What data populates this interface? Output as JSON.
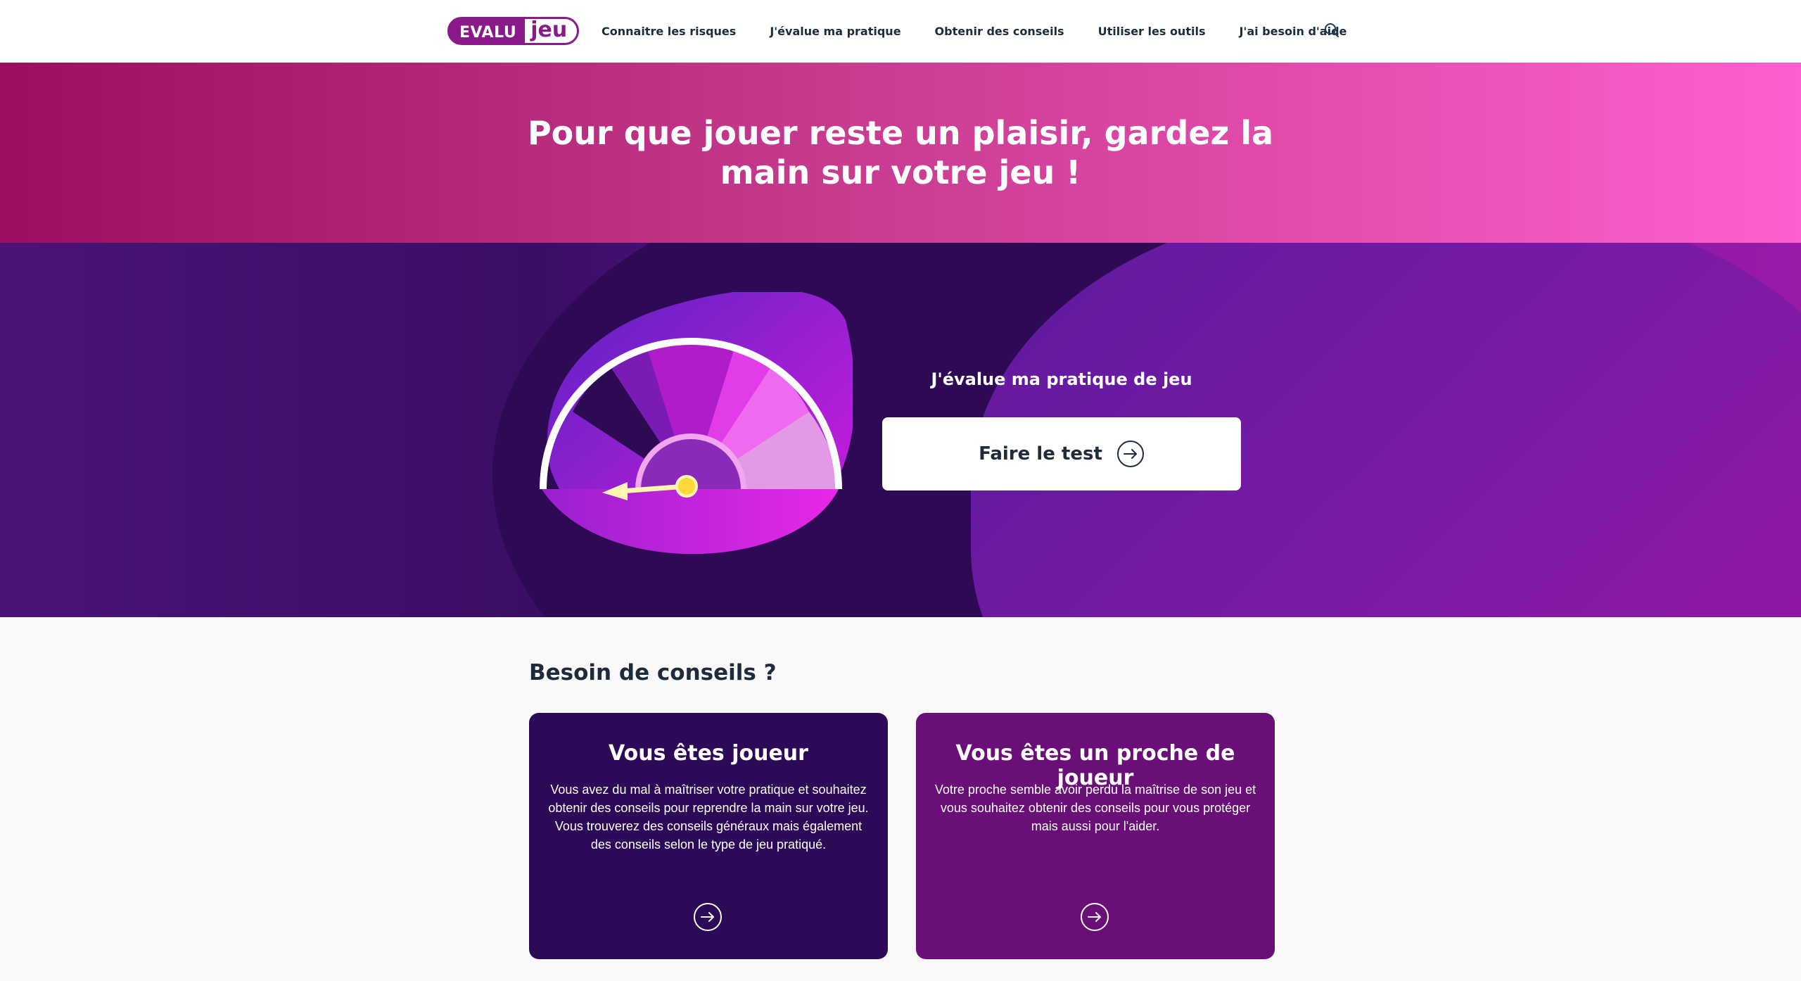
{
  "header": {
    "logo": {
      "part1": "EVALU",
      "part2": "jeu"
    },
    "nav": [
      "Connaitre les risques",
      "J'évalue ma pratique",
      "Obtenir des conseils",
      "Utiliser les outils",
      "J'ai besoin d'aide"
    ],
    "search_icon": "search-icon"
  },
  "banner": {
    "title": "Pour que jouer reste un plaisir, gardez la main sur votre jeu !"
  },
  "hero": {
    "label": "J'évalue ma pratique de jeu",
    "cta_label": "Faire le test",
    "cta_icon": "arrow-right-circle-icon",
    "gauge_icon": "gauge-meter-icon"
  },
  "advice": {
    "title": "Besoin de conseils ?",
    "cards": [
      {
        "title": "Vous êtes joueur",
        "text": "Vous avez du mal à maîtriser votre pratique et souhaitez obtenir des conseils pour reprendre la main sur votre jeu. Vous trouverez des conseils généraux mais également des conseils selon le type de jeu pratiqué.",
        "icon": "arrow-right-circle-icon"
      },
      {
        "title": "Vous êtes un proche de joueur",
        "text": "Votre proche semble avoir perdu la maîtrise de son jeu et vous souhaitez obtenir des conseils pour vous protéger mais aussi pour l'aider.",
        "icon": "arrow-right-circle-icon"
      }
    ]
  },
  "colors": {
    "brand_purple": "#8a1a8a",
    "banner_start": "#9a0f5e",
    "banner_end": "#ff5fce",
    "hero_dark": "#2e0a55",
    "card_1": "#2d0a57",
    "card_2": "#6b0f78",
    "text_dark": "#1d2b3a"
  }
}
